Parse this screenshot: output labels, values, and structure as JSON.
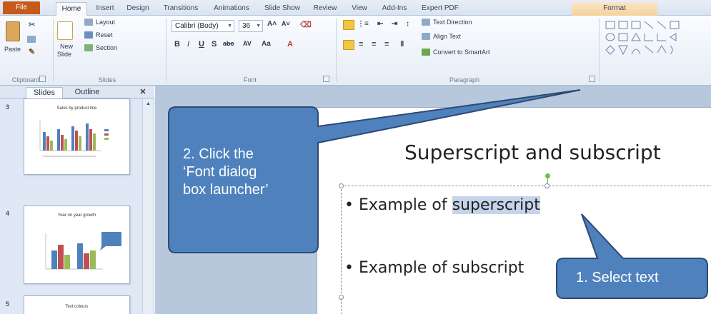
{
  "tabs": [
    {
      "label": "File"
    },
    {
      "label": "Home"
    },
    {
      "label": "Insert"
    },
    {
      "label": "Design"
    },
    {
      "label": "Transitions"
    },
    {
      "label": "Animations"
    },
    {
      "label": "Slide Show"
    },
    {
      "label": "Review"
    },
    {
      "label": "View"
    },
    {
      "label": "Add-Ins"
    },
    {
      "label": "Expert PDF"
    },
    {
      "label": "Format"
    }
  ],
  "ribbon": {
    "clipboard": {
      "paste": "Paste",
      "label": "Clipboard"
    },
    "slides": {
      "new_slide_1": "New",
      "new_slide_2": "Slide",
      "layout": "Layout",
      "reset": "Reset",
      "section": "Section",
      "label": "Slides"
    },
    "font": {
      "name": "Calibri (Body)",
      "size": "36",
      "label": "Font"
    },
    "paragraph": {
      "text_direction": "Text Direction",
      "align_text": "Align Text",
      "convert": "Convert to SmartArt",
      "label": "Paragraph"
    }
  },
  "left_pane": {
    "tabs": [
      "Slides",
      "Outline"
    ],
    "close": "✕",
    "thumbs": [
      {
        "num": "3",
        "title": "Sales by product line"
      },
      {
        "num": "4",
        "title": "Year on year growth"
      },
      {
        "num": "5",
        "title": "Text colours"
      }
    ]
  },
  "slide": {
    "title": "Superscript and subscript",
    "bullet1_prefix": "Example of ",
    "bullet1_selected": "superscript",
    "bullet2": "Example of subscript"
  },
  "callouts": {
    "step2": [
      "2. Click the",
      "‘Font dialog",
      "box launcher’"
    ],
    "step1": "1. Select text",
    "fill": "#4f81bd",
    "stroke": "#2c4a74"
  },
  "colors": {
    "file_tab": "#c75a1a",
    "selection": "#c5d4ea"
  }
}
